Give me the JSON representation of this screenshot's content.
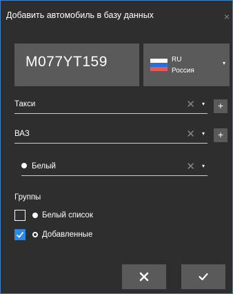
{
  "window": {
    "title": "Добавить автомобиль в базу данных",
    "close_glyph": "×"
  },
  "plate": {
    "number": "M077YT159"
  },
  "country": {
    "code": "RU",
    "name": "Россия",
    "flag_colors": [
      "#ffffff",
      "#2a6fd6",
      "#e05a5a"
    ],
    "caret": "▾"
  },
  "fields": {
    "category": {
      "value": "Такси",
      "clear": "✕",
      "caret": "▾",
      "add": "+"
    },
    "brand": {
      "value": "ВАЗ",
      "clear": "✕",
      "caret": "▾",
      "add": "+"
    },
    "color": {
      "value": "Белый",
      "clear": "✕",
      "caret": "▾"
    }
  },
  "groups": {
    "title": "Группы",
    "items": [
      {
        "label": "Белый список",
        "checked": false,
        "marker": "filled-dot"
      },
      {
        "label": "Добавленные",
        "checked": true,
        "marker": "ring-dot"
      }
    ]
  },
  "footer": {
    "cancel_icon": "close-icon",
    "confirm_icon": "checkmark-icon"
  },
  "colors": {
    "accent": "#2b8ae6",
    "window_border": "#4a7fc0",
    "panel": "#5a5a5a",
    "background": "#2e2e2e"
  }
}
